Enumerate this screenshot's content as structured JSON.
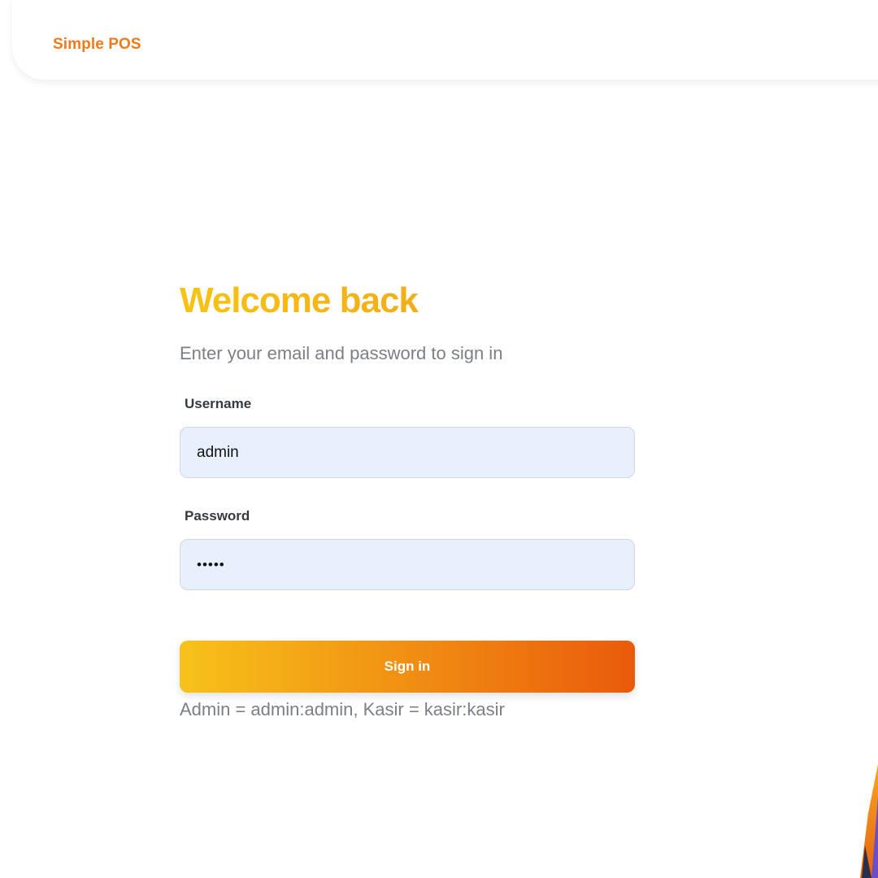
{
  "navbar": {
    "brand": "Simple POS"
  },
  "login": {
    "title": "Welcome back",
    "subtitle": "Enter your email and password to sign in",
    "username_label": "Username",
    "username_value": "admin",
    "password_label": "Password",
    "password_value": "admin",
    "signin_label": "Sign in",
    "hint": "Admin = admin:admin, Kasir = kasir:kasir"
  },
  "colors": {
    "brand": "#f27a1a",
    "input_bg": "#e8f0fe",
    "button_start": "#f7c21a",
    "button_end": "#ea5a0c"
  }
}
